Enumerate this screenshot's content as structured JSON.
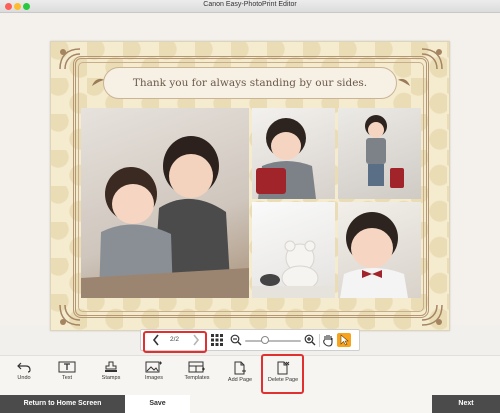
{
  "window": {
    "title": "Canon Easy-PhotoPrint Editor"
  },
  "banner": {
    "text": "Thank you for always standing by our sides."
  },
  "navigation": {
    "page_indicator": "2/2",
    "zoom_minus": "−",
    "zoom_plus": "+"
  },
  "tools": [
    {
      "label": "Undo",
      "icon": "undo-icon"
    },
    {
      "label": "Text",
      "icon": "text-icon"
    },
    {
      "label": "Stamps",
      "icon": "stamps-icon"
    },
    {
      "label": "Images",
      "icon": "images-icon"
    },
    {
      "label": "Templates",
      "icon": "templates-icon"
    },
    {
      "label": "Add Page",
      "icon": "add-page-icon"
    },
    {
      "label": "Delete Page",
      "icon": "delete-page-icon"
    }
  ],
  "bottom": {
    "return_label": "Return to Home Screen",
    "save_label": "Save",
    "next_label": "Next"
  },
  "colors": {
    "highlight": "#e03030",
    "accent": "#f7a31b",
    "dark_button": "#4b4b4b"
  }
}
